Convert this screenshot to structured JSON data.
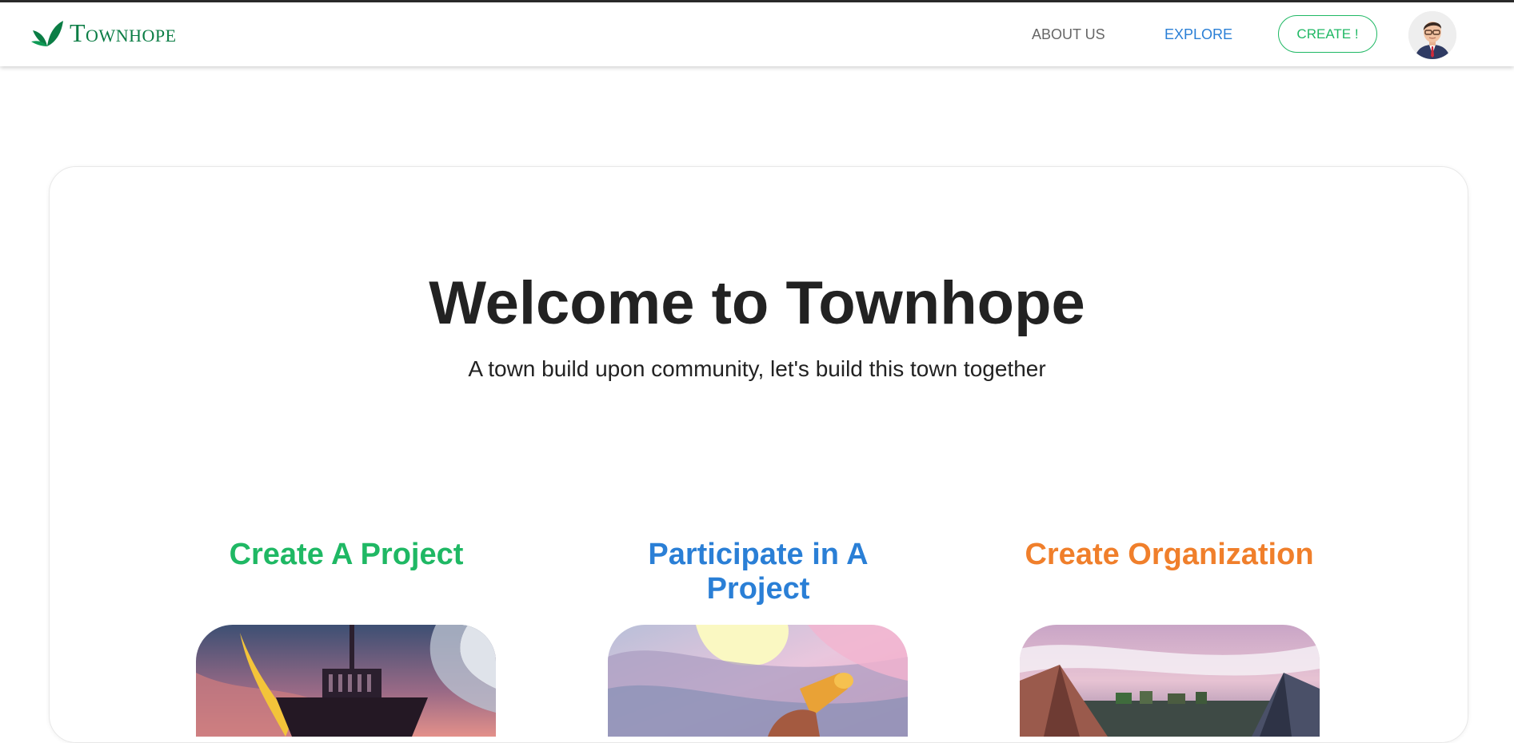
{
  "brand": {
    "name": "Townhope",
    "logo_icon": "leaf-icon",
    "color": "#0b7d45"
  },
  "nav": {
    "about_label": "ABOUT US",
    "explore_label": "EXPLORE",
    "create_label": "CREATE !",
    "avatar_icon": "user-avatar-icon"
  },
  "hero": {
    "title": "Welcome to Townhope",
    "subtitle": "A town build upon community, let's build this town together"
  },
  "features": [
    {
      "title": "Create A Project",
      "color": "#1fb864"
    },
    {
      "title": "Participate in A Project",
      "color": "#2a7fd6"
    },
    {
      "title": "Create Organization",
      "color": "#f07f2b"
    }
  ]
}
